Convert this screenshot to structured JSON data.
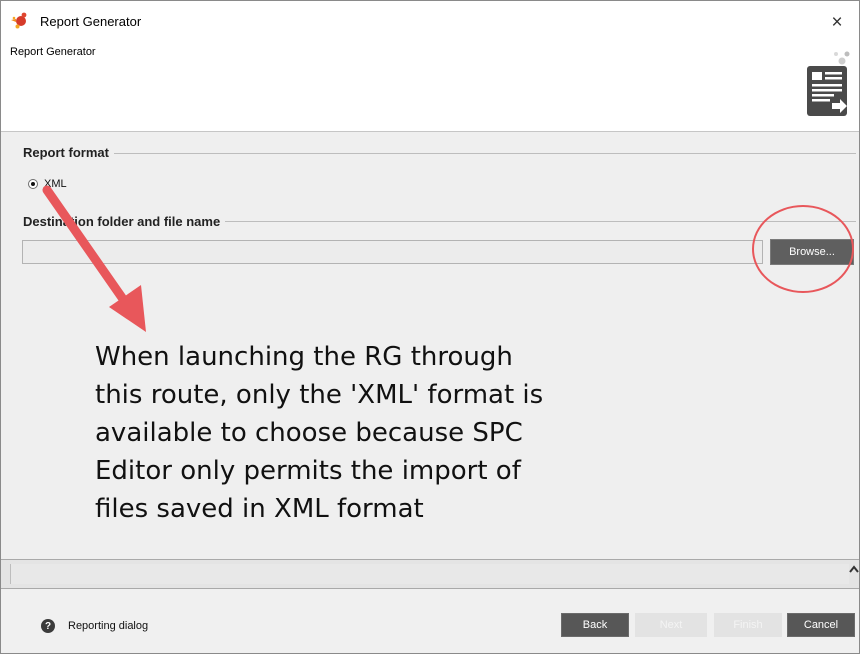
{
  "window": {
    "title": "Report Generator",
    "close_glyph": "×",
    "icons": {
      "app": "report-generator-app-icon",
      "close": "close-icon"
    }
  },
  "header": {
    "subtitle": "Report Generator",
    "icon": "report-generator-icon"
  },
  "report_format": {
    "section_title": "Report format",
    "options": [
      {
        "label": "XML",
        "selected": true
      }
    ]
  },
  "destination": {
    "section_title": "Destination folder and file name",
    "value": "",
    "browse_label": "Browse..."
  },
  "annotation": {
    "color": "#e8575b",
    "lines": [
      "When launching the RG through",
      "this route, only the 'XML' format is",
      "available to choose because SPC",
      "Editor only permits the import of",
      "files saved in XML format"
    ]
  },
  "footer": {
    "help_glyph": "?",
    "help_label": "Reporting dialog",
    "buttons": {
      "back": "Back",
      "next": "Next",
      "finish": "Finish",
      "cancel": "Cancel"
    }
  },
  "colors": {
    "button_active": "#575757",
    "button_disabled": "#e3e3e3",
    "background": "#efefef"
  }
}
